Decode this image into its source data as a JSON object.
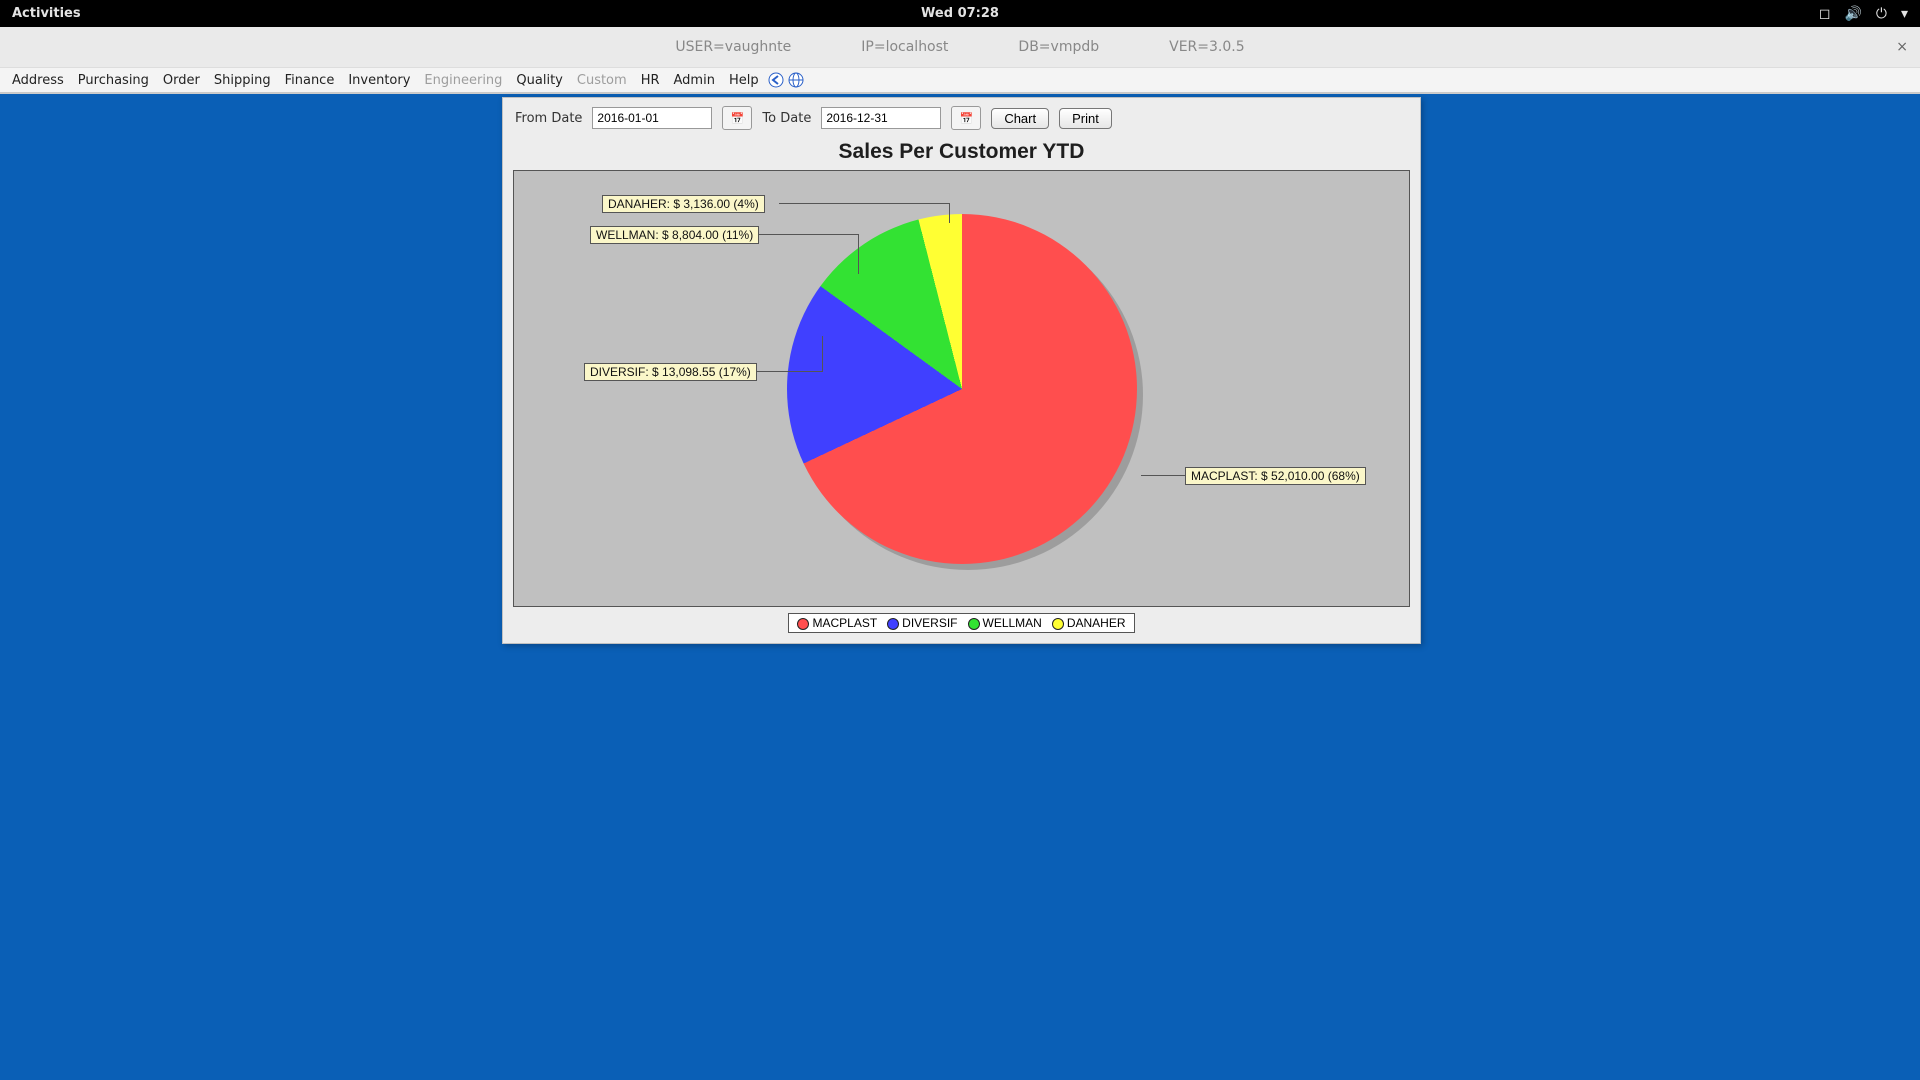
{
  "gnome": {
    "activities": "Activities",
    "clock": "Wed 07:28"
  },
  "app": {
    "user": "USER=vaughnte",
    "ip": "IP=localhost",
    "db": "DB=vmpdb",
    "ver": "VER=3.0.5",
    "close_glyph": "×"
  },
  "menu": {
    "items": [
      "Address",
      "Purchasing",
      "Order",
      "Shipping",
      "Finance",
      "Inventory",
      "Engineering",
      "Quality",
      "Custom",
      "HR",
      "Admin",
      "Help"
    ],
    "disabled_indices": [
      6,
      8
    ]
  },
  "controls": {
    "from_label": "From Date",
    "from_value": "2016-01-01",
    "to_label": "To Date",
    "to_value": "2016-12-31",
    "chart_btn": "Chart",
    "print_btn": "Print"
  },
  "chart_data": {
    "type": "pie",
    "title": "Sales Per Customer YTD",
    "series_name": "Sales",
    "slices": [
      {
        "name": "MACPLAST",
        "value": 52010.0,
        "percent": 68,
        "color": "#ff4e4e",
        "label": "MACPLAST: $ 52,010.00 (68%)"
      },
      {
        "name": "DIVERSIF",
        "value": 13098.55,
        "percent": 17,
        "color": "#4040ff",
        "label": "DIVERSIF: $ 13,098.55 (17%)"
      },
      {
        "name": "WELLMAN",
        "value": 8804.0,
        "percent": 11,
        "color": "#33e233",
        "label": "WELLMAN: $ 8,804.00 (11%)"
      },
      {
        "name": "DANAHER",
        "value": 3136.0,
        "percent": 4,
        "color": "#ffff33",
        "label": "DANAHER: $ 3,136.00 (4%)"
      }
    ],
    "legend": [
      "MACPLAST",
      "DIVERSIF",
      "WELLMAN",
      "DANAHER"
    ]
  }
}
